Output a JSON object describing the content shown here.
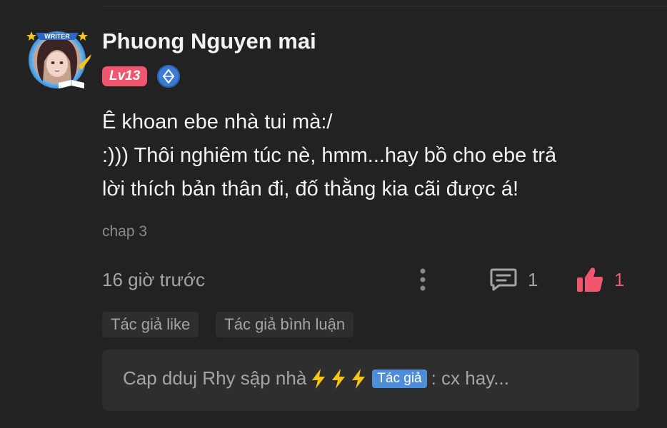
{
  "user": {
    "name": "Phuong Nguyen mai",
    "avatar_frame_text": "WRITER",
    "level": "Lv13"
  },
  "comment": {
    "lines": [
      "Ê khoan ebe nhà tui mà:/",
      ":))) Thôi nghiêm túc nè, hmm...hay bồ cho ebe trả",
      "lời thích bản thân đi, đố thằng kia cãi được á!"
    ],
    "chapter": "chap 3",
    "timestamp": "16 giờ trước",
    "reply_count": "1",
    "like_count": "1"
  },
  "tags": [
    "Tác giả like",
    "Tác giả bình luận"
  ],
  "reply_preview": {
    "username": "Cap dduj Rhy sập nhà",
    "author_badge": "Tác giả",
    "text": ": cx hay..."
  },
  "colors": {
    "background": "#222222",
    "card": "#2e2e2e",
    "accent_pink": "#f0566e",
    "author_blue": "#4e8ed9",
    "bolt_yellow": "#f5c518"
  },
  "icons": {
    "more": "vertical-ellipsis-icon",
    "reply": "comment-bubble-icon",
    "like": "thumbs-up-icon",
    "gem": "gem-icon",
    "bolt": "lightning-bolt-icon"
  }
}
